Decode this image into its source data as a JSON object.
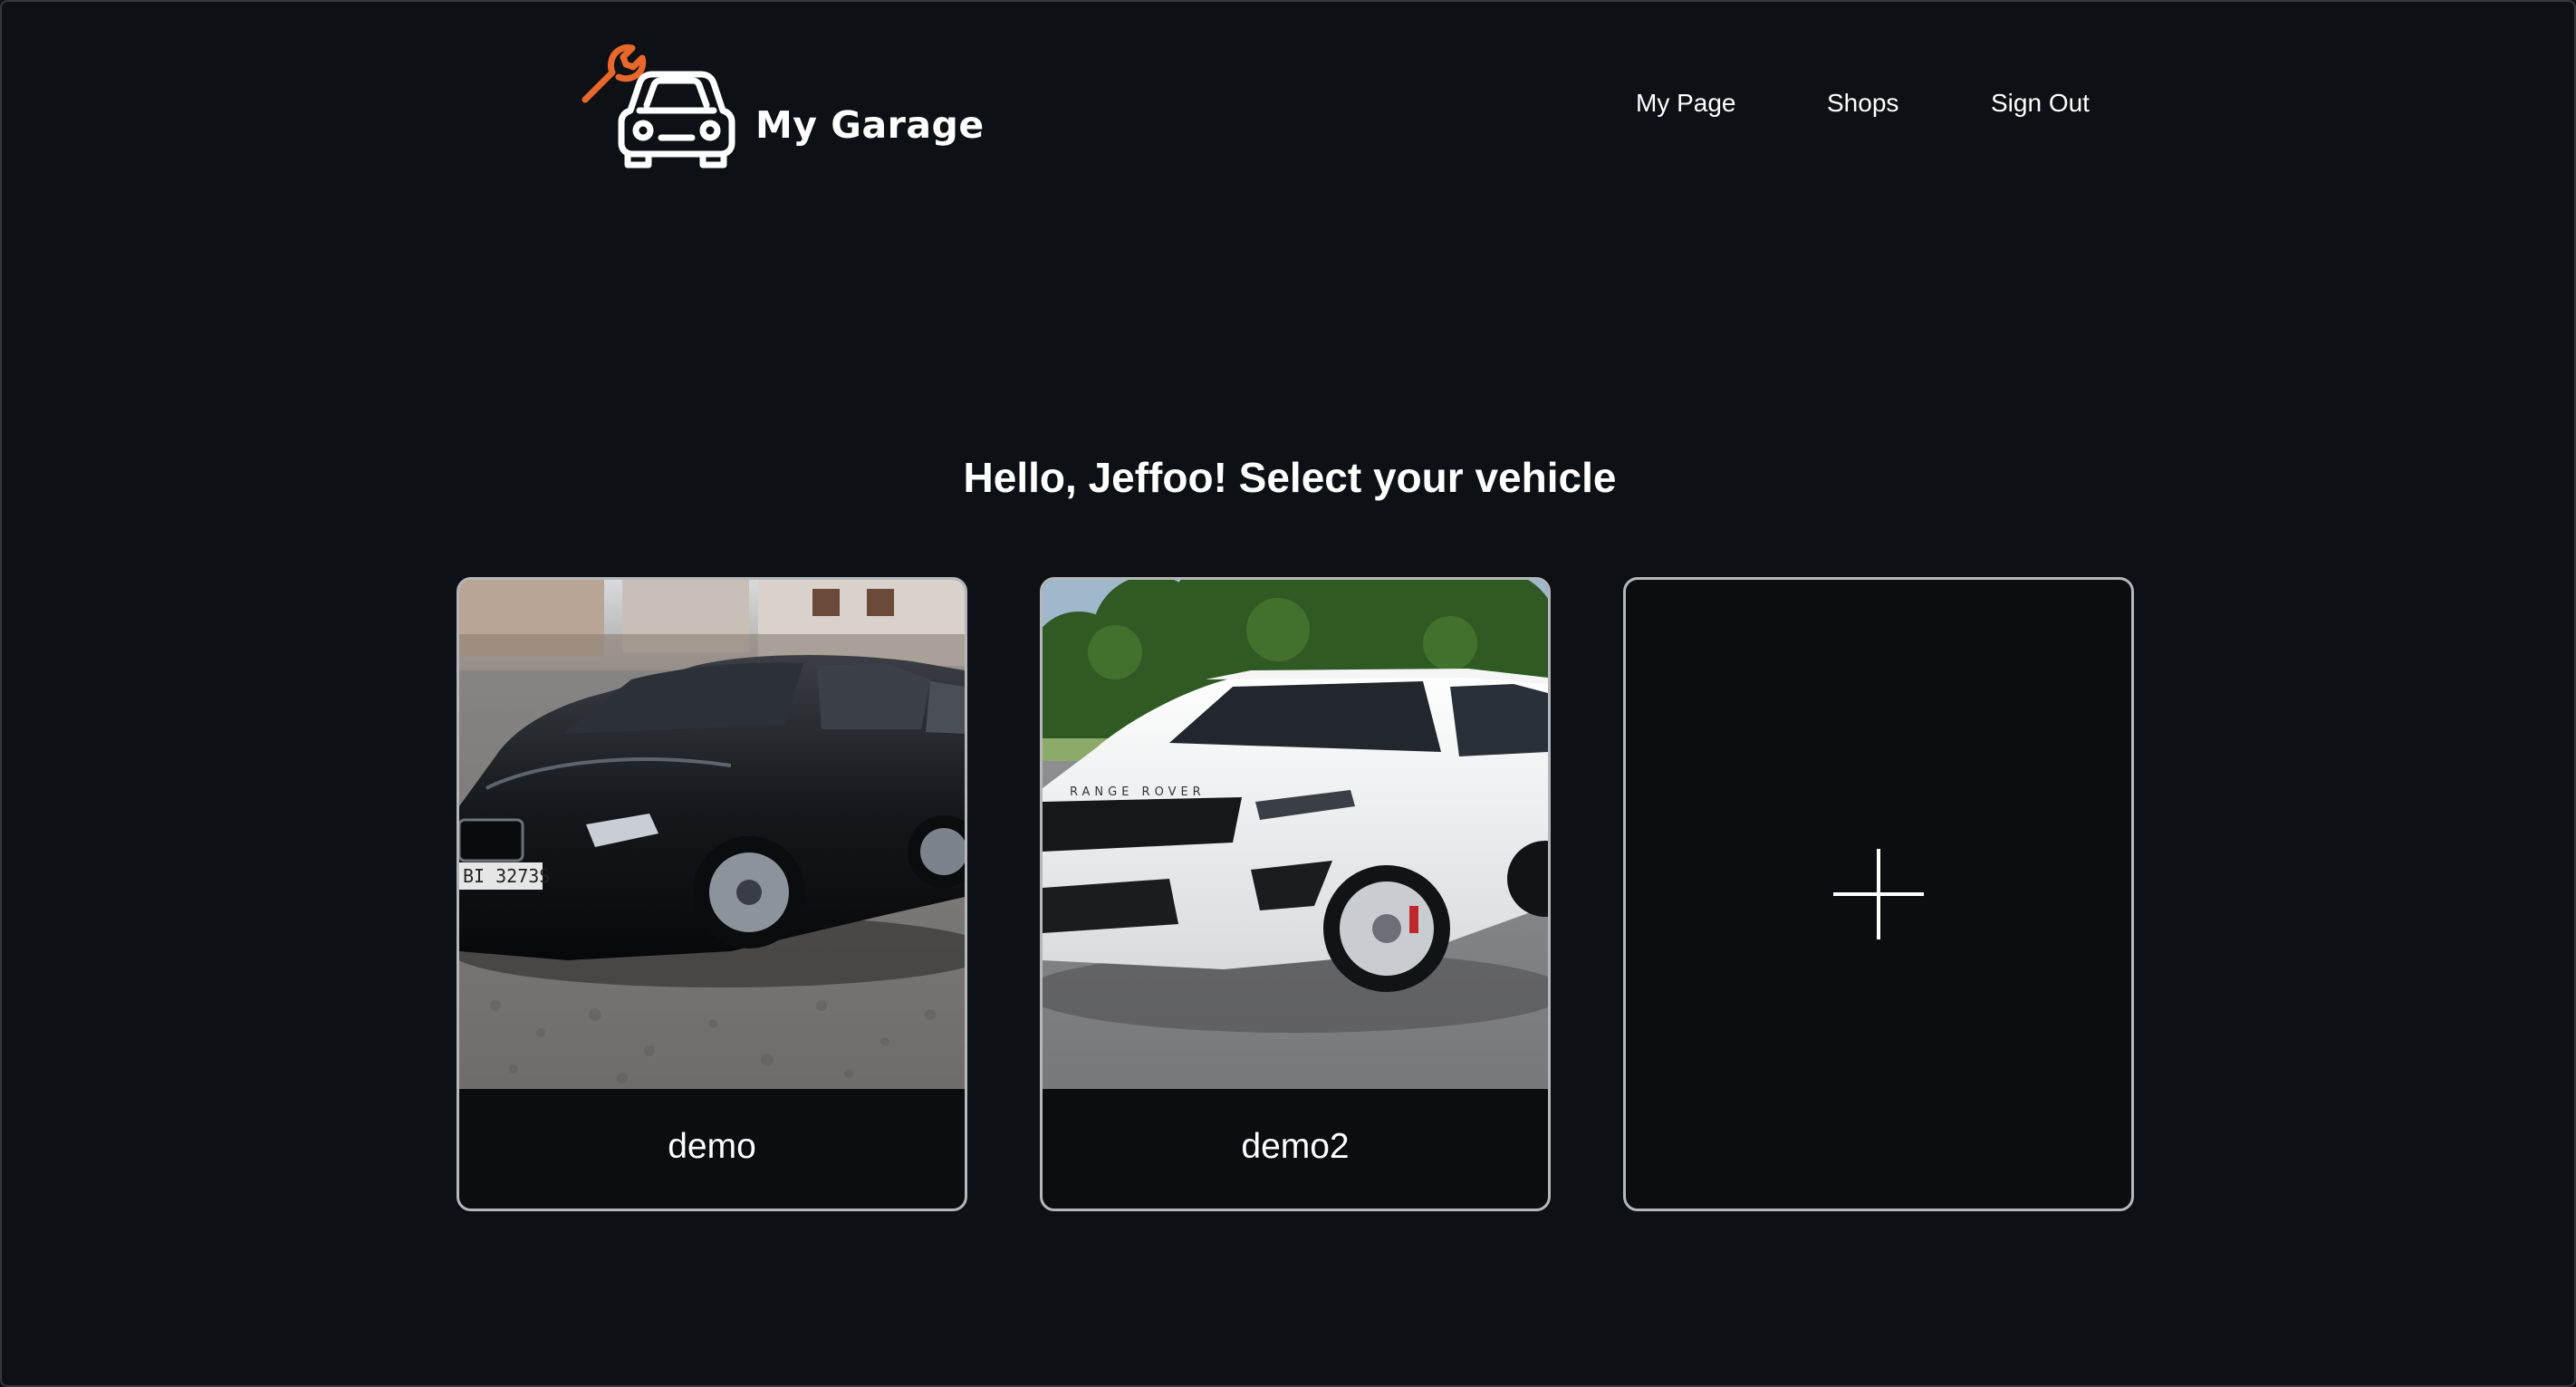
{
  "header": {
    "brand": "My Garage",
    "logo_icon": "car-wrench-icon",
    "nav": [
      "My Page",
      "Shops",
      "Sign Out"
    ]
  },
  "main": {
    "greeting": "Hello, Jeffoo! Select your vehicle",
    "vehicles": [
      {
        "name": "demo",
        "photo": "black-sedan-photo",
        "plate": "BI 3273S"
      },
      {
        "name": "demo2",
        "photo": "white-suv-photo",
        "badge": "RANGE ROVER"
      }
    ],
    "add_vehicle_icon": "plus-icon"
  },
  "colors": {
    "background": "#0d1014",
    "card_border": "#b5b7ba",
    "accent": "#e8672a",
    "text": "#ffffff"
  }
}
